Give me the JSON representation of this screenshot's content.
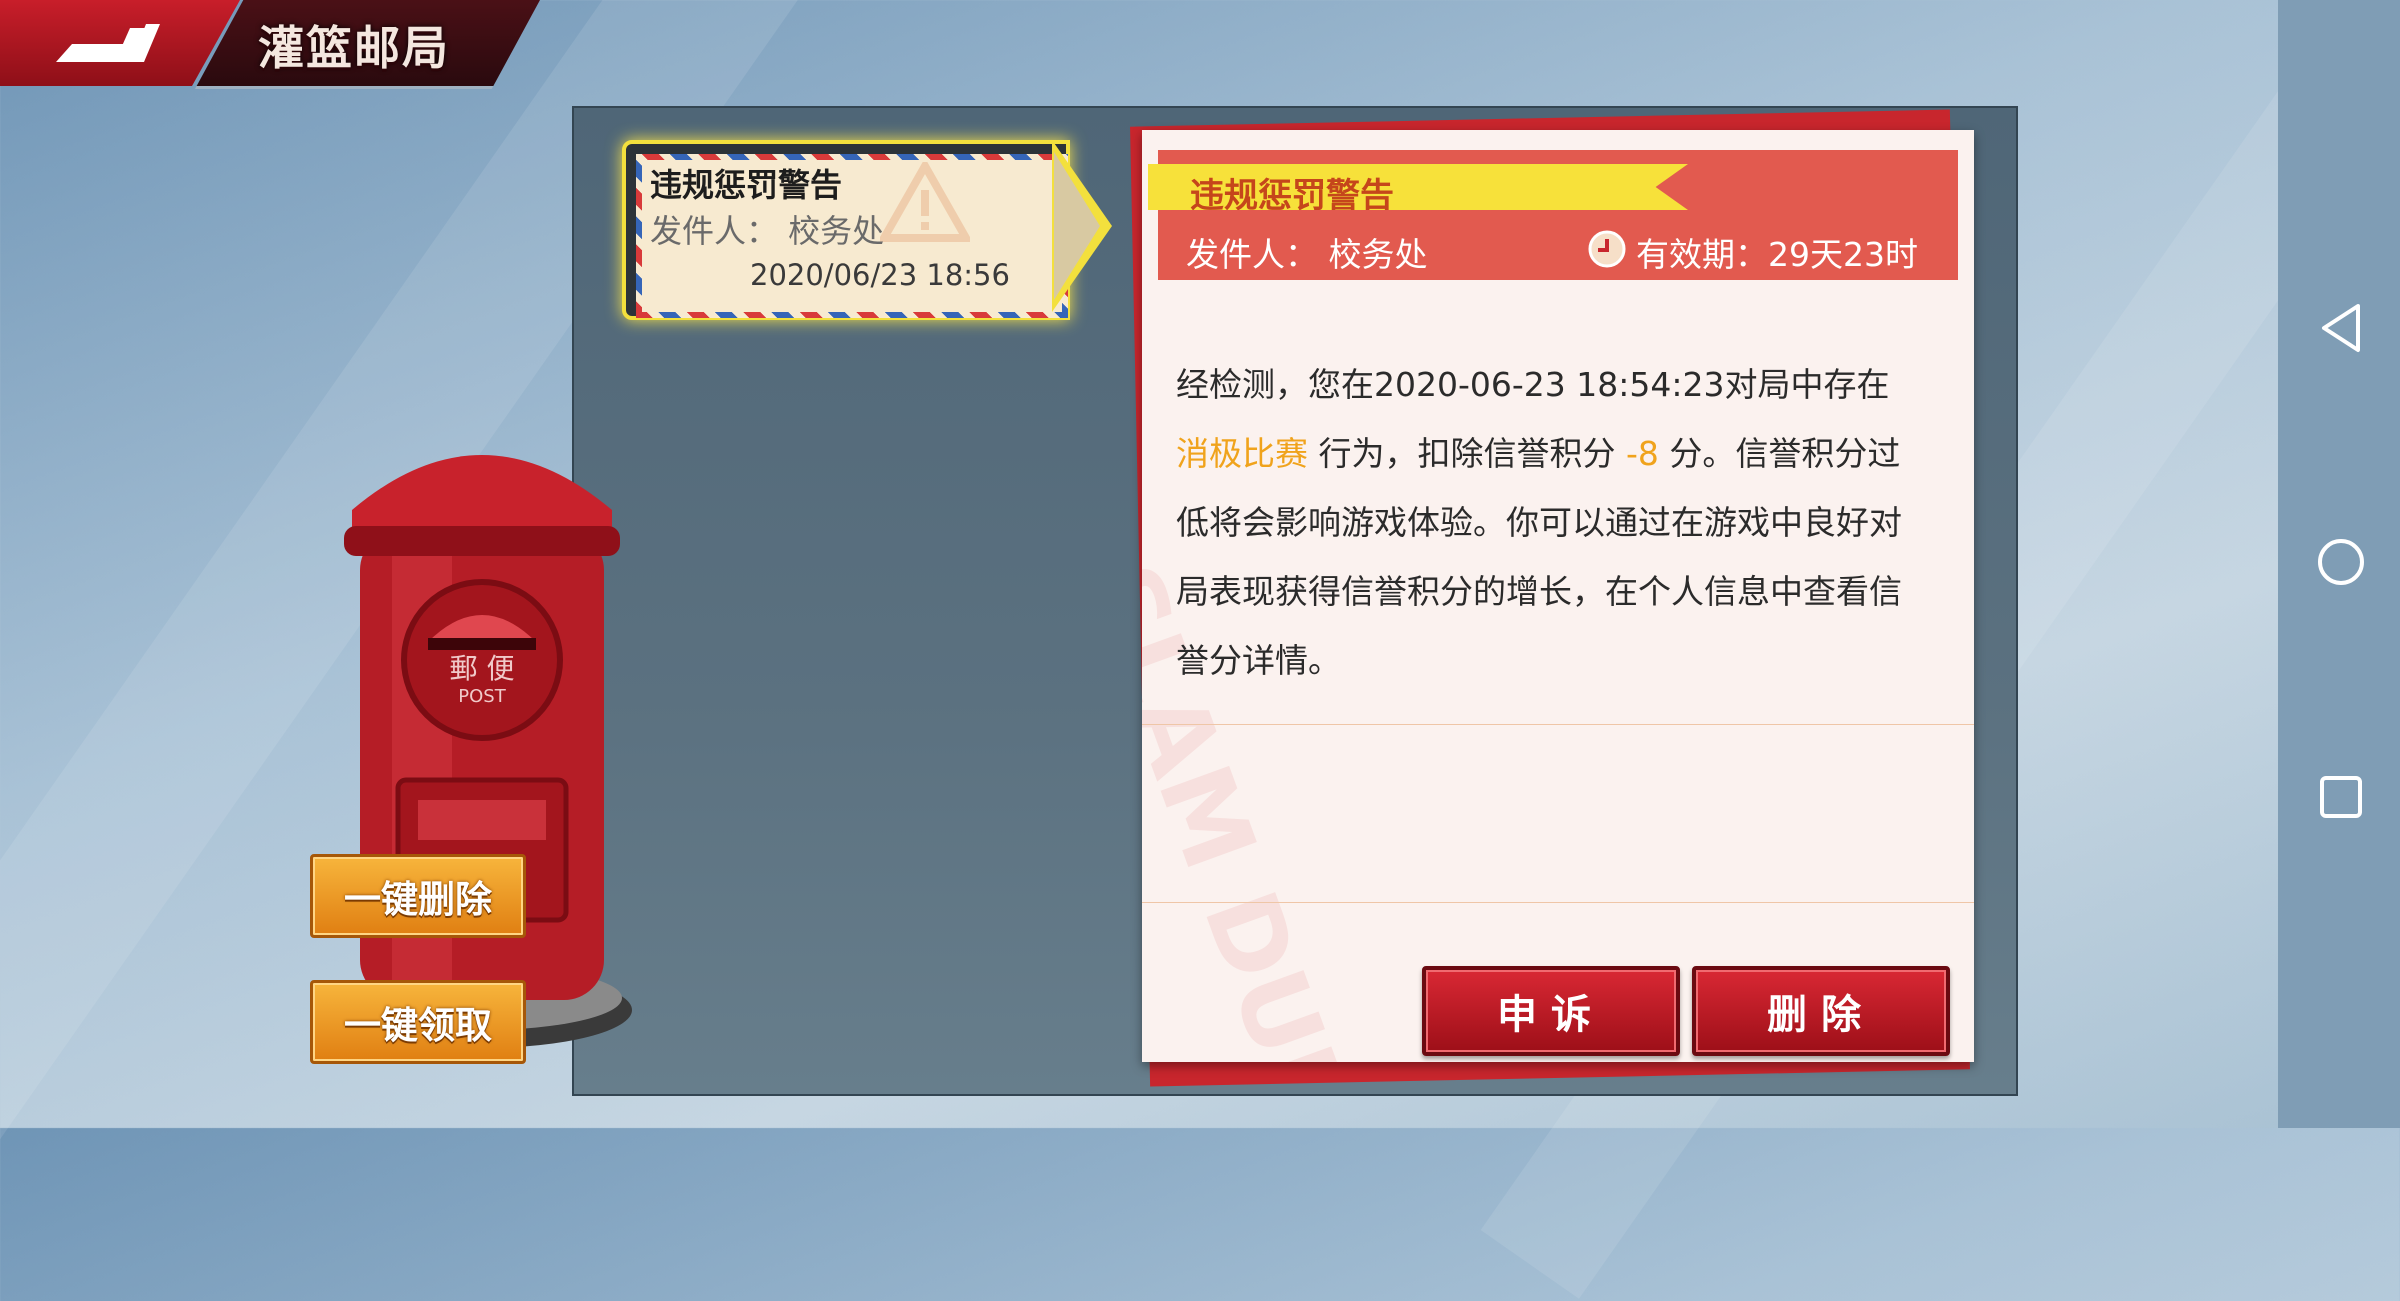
{
  "app": {
    "title": "灌篮邮局"
  },
  "mail_list": [
    {
      "title": "违规惩罚警告",
      "sender": "发件人： 校务处",
      "date": "2020/06/23 18:56"
    }
  ],
  "letter": {
    "title": "违规惩罚警告",
    "sender": "发件人： 校务处",
    "expire": "有效期：29天23时",
    "body": {
      "p1": "经检测，您在2020-06-23 18:54:23对局中存在",
      "highlight1": "消极比赛",
      "p2": " 行为，扣除信誉积分 ",
      "highlight2": "-8",
      "p3": " 分。信誉积分过低将会影响游戏体验。你可以通过在游戏中良好对局表现获得信誉积分的增长，在个人信息中查看信誉分详情。"
    },
    "watermark": "SLAM DUNK",
    "appeal_label": "申诉",
    "delete_label": "删除"
  },
  "postbox": {
    "plate": "郵 便",
    "plate_sub": "POST"
  },
  "side_buttons": {
    "delete_all": "一键删除",
    "claim_all": "一键领取"
  },
  "colors": {
    "accent_red": "#c8262d",
    "highlight": "#f0a31c",
    "banner_yellow": "#f7e13a"
  },
  "icons": {
    "back": "back-arrow-icon",
    "clock": "clock-icon",
    "warning": "warning-icon",
    "nav_back": "triangle-back-icon",
    "nav_home": "circle-home-icon",
    "nav_recent": "square-recent-icon"
  }
}
